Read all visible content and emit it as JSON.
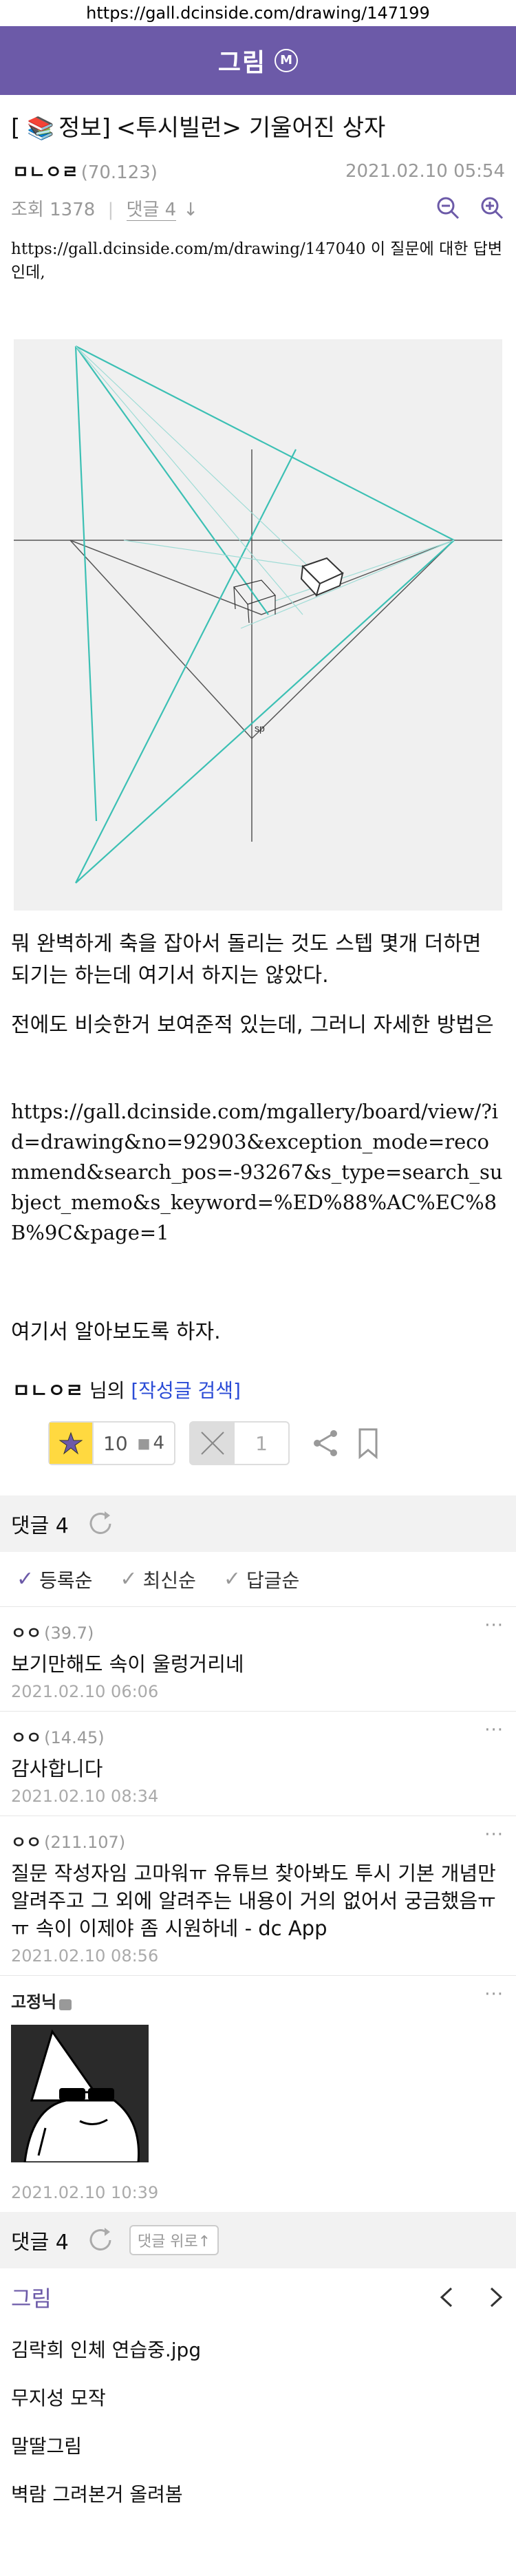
{
  "browser": {
    "url": "https://gall.dcinside.com/drawing/147199"
  },
  "header": {
    "title": "그림",
    "badge": "M"
  },
  "post": {
    "category": "[",
    "category_label": "정보]",
    "title": "<투시빌런> 기울어진 상자",
    "author": "ㅁㄴㅇㄹ",
    "author_ip": "(70.123)",
    "date": "2021.02.10 05:54",
    "views": "조회 1378",
    "comments_label": "댓글 4",
    "intro": "https://gall.dcinside.com/m/drawing/147040 이 질문에 대한 답변인데,",
    "para1": "뭐 완벽하게 축을 잡아서 돌리는 것도 스텝 몇개 더하면 되기는 하는데 여기서 하지는 않았다.",
    "para2": "전에도 비슷한거 보여준적 있는데, 그러니 자세한 방법은",
    "url2": "https://gall.dcinside.com/mgallery/board/view/?id=drawing&no=92903&exception_mode=recommend&search_pos=-93267&s_type=search_subject_memo&s_keyword=%ED%88%AC%EC%8B%9C&page=1",
    "para3": "여기서 알아보도록 하자.",
    "figure_label": "sp",
    "byline_author": "ㅁㄴㅇㄹ",
    "byline_mid": " 님의 ",
    "byline_link": "[작성글 검색]"
  },
  "reactions": {
    "recommend": "10",
    "fixed_recommend": "4",
    "non_recommend": "1"
  },
  "comments_bar": {
    "label": "댓글 4"
  },
  "sort": {
    "opt1": "등록순",
    "opt2": "최신순",
    "opt3": "답글순"
  },
  "comments": [
    {
      "nick": "ㅇㅇ",
      "ip": "(39.7)",
      "text": "보기만해도 속이 울렁거리네",
      "date": "2021.02.10 06:06"
    },
    {
      "nick": "ㅇㅇ",
      "ip": "(14.45)",
      "text": "감사합니다",
      "date": "2021.02.10 08:34"
    },
    {
      "nick": "ㅇㅇ",
      "ip": "(211.107)",
      "text": "질문 작성자임 고마워ㅠ 유튜브 찾아봐도 투시 기본 개념만 알려주고 그 외에 알려주는 내용이 거의 없어서 궁금했음ㅠㅠ 속이 이제야 좀 시원하네 - dc App",
      "date": "2021.02.10 08:56"
    },
    {
      "nick": "고정닉",
      "ip": "",
      "text": "",
      "date": "2021.02.10 10:39"
    }
  ],
  "bottom_bar": {
    "label": "댓글 4",
    "up": "댓글 위로↑"
  },
  "board": {
    "name": "그림"
  },
  "related": [
    "김락희 인체 연습중.jpg",
    "무지성 모작",
    "말딸그림",
    "벽람 그려본거 올려봄"
  ],
  "dots": "···",
  "colors": {
    "brand": "#6c5aa8",
    "link": "#2a4bd6",
    "cyan": "#3cc0b4"
  }
}
